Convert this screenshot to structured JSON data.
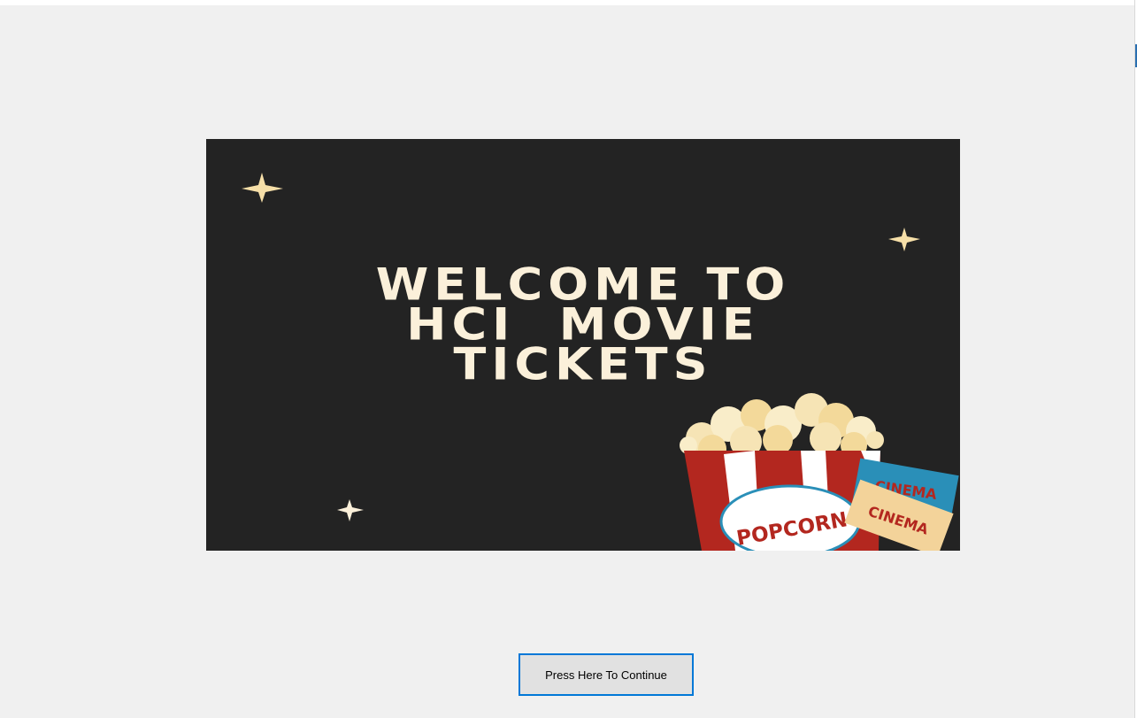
{
  "banner": {
    "headline_lines": [
      "WELCOME TO",
      "HCI  MOVIE",
      "TICKETS"
    ],
    "popcorn_label": "POPCORN",
    "ticket_label_1": "CINEMA",
    "ticket_label_2": "CINEMA",
    "colors": {
      "background": "#232323",
      "headline": "#fbf0da",
      "star": "#f6dfa8",
      "popcorn_red": "#b3271f",
      "ticket_blue": "#2a8fb8",
      "ticket_cream": "#f3d39a"
    }
  },
  "continue_button": {
    "label": "Press Here To Continue"
  }
}
